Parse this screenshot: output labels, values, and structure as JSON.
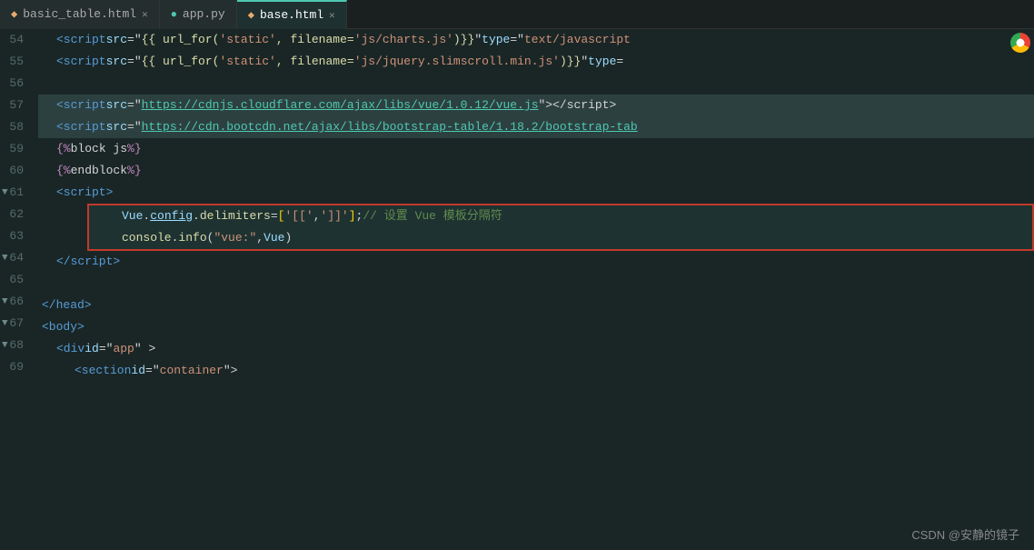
{
  "tabs": [
    {
      "id": "tab-basic",
      "label": "basic_table.html",
      "icon": "html",
      "active": false,
      "closable": true
    },
    {
      "id": "tab-app",
      "label": "app.py",
      "icon": "py",
      "active": false,
      "closable": false
    },
    {
      "id": "tab-base",
      "label": "base.html",
      "icon": "html",
      "active": true,
      "closable": true
    }
  ],
  "lines": [
    {
      "num": 54,
      "indent": 1,
      "content": "script_src_charts"
    },
    {
      "num": 55,
      "indent": 1,
      "content": "script_src_jquery"
    },
    {
      "num": 56,
      "indent": 0,
      "content": "empty"
    },
    {
      "num": 57,
      "indent": 1,
      "content": "script_cloudflare",
      "selected": true
    },
    {
      "num": 58,
      "indent": 1,
      "content": "script_bootcdn",
      "selected": true
    },
    {
      "num": 59,
      "indent": 1,
      "content": "block_js"
    },
    {
      "num": 60,
      "indent": 1,
      "content": "endblock_js"
    },
    {
      "num": 61,
      "indent": 1,
      "content": "script_open",
      "fold": true
    },
    {
      "num": 62,
      "indent": 2,
      "content": "vue_config",
      "boxed": true
    },
    {
      "num": 63,
      "indent": 2,
      "content": "console_info",
      "boxed": true
    },
    {
      "num": 64,
      "indent": 1,
      "content": "script_close",
      "fold": true
    },
    {
      "num": 65,
      "indent": 0,
      "content": "empty"
    },
    {
      "num": 66,
      "indent": 0,
      "content": "head_close",
      "fold": true
    },
    {
      "num": 67,
      "indent": 0,
      "content": "body_open",
      "fold": true
    },
    {
      "num": 68,
      "indent": 1,
      "content": "div_app",
      "fold": true
    },
    {
      "num": 69,
      "indent": 2,
      "content": "section_container"
    }
  ],
  "watermark": "CSDN @安静的镜子"
}
